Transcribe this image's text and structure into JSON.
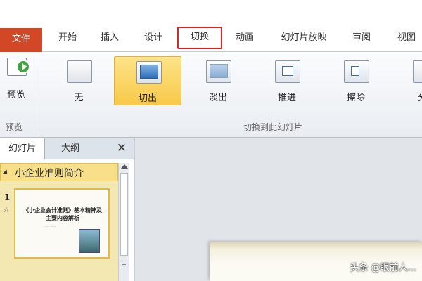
{
  "menu": {
    "tabs": [
      "文件",
      "开始",
      "插入",
      "设计",
      "切换",
      "动画",
      "幻灯片放映",
      "审阅",
      "视图"
    ]
  },
  "ribbon": {
    "preview_label": "预览",
    "preview_group_label": "预览",
    "transitions_group_label": "切换到此幻灯片",
    "transitions": [
      "无",
      "切出",
      "淡出",
      "推进",
      "擦除",
      "分"
    ]
  },
  "pane": {
    "tabs": [
      "幻灯片",
      "大纲"
    ],
    "close": "✕",
    "section_title": "小企业准则简介",
    "slide_number": "1",
    "slide_star": "☆",
    "slide_title": "《小企业会计准则》基本精神及主要内容解析",
    "slide_subtitle": "·· ·· ·· ··"
  },
  "watermark": "头条 @眼前人..."
}
